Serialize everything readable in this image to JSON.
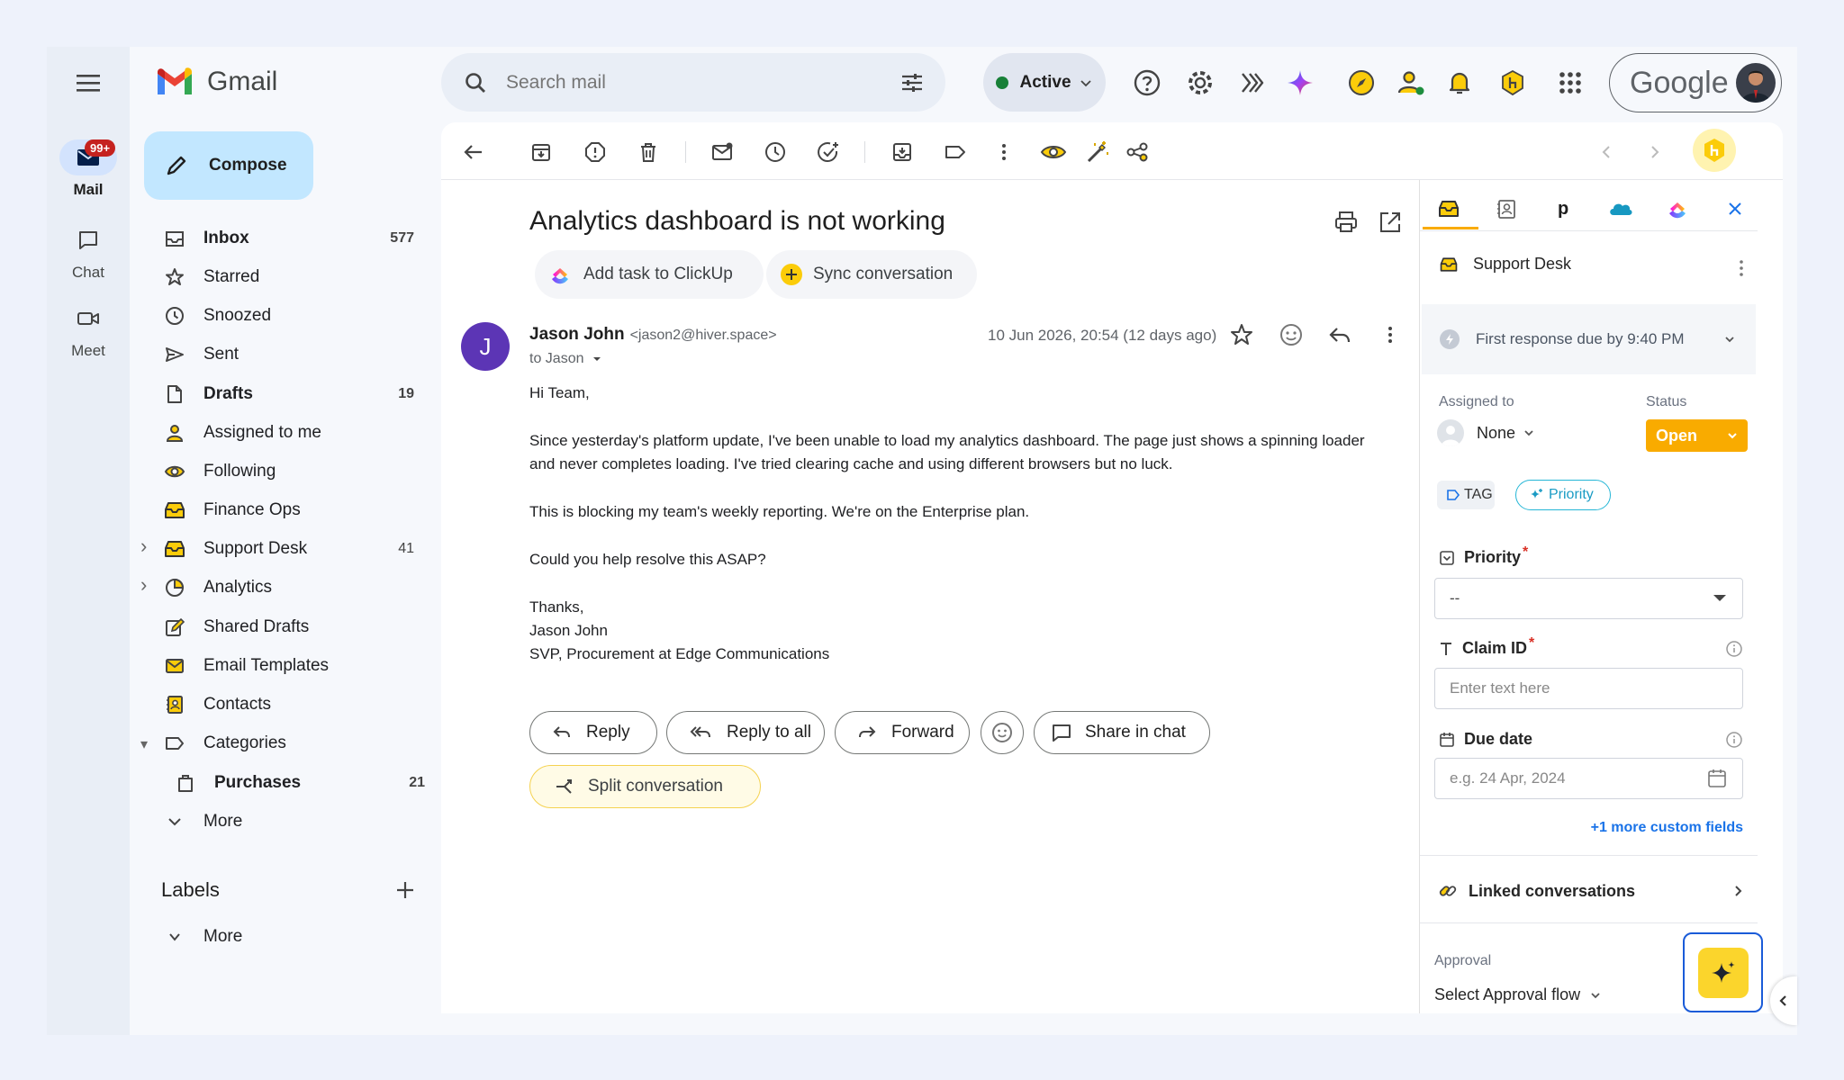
{
  "app": {
    "name": "Gmail"
  },
  "rail": [
    {
      "label": "Mail",
      "badge": "99+"
    },
    {
      "label": "Chat"
    },
    {
      "label": "Meet"
    }
  ],
  "compose": {
    "label": "Compose"
  },
  "nav": [
    {
      "label": "Inbox",
      "count": "577",
      "bold": true,
      "icon": "inbox-icon"
    },
    {
      "label": "Starred",
      "count": "",
      "icon": "star-icon"
    },
    {
      "label": "Snoozed",
      "count": "",
      "icon": "clock-icon"
    },
    {
      "label": "Sent",
      "count": "",
      "icon": "send-icon"
    },
    {
      "label": "Drafts",
      "count": "19",
      "bold": true,
      "icon": "draft-icon"
    },
    {
      "label": "Assigned to me",
      "count": "",
      "icon": "person-icon"
    },
    {
      "label": "Following",
      "count": "",
      "icon": "eye-icon"
    },
    {
      "label": "Finance Ops",
      "count": "",
      "icon": "shared-inbox-icon"
    },
    {
      "label": "Support Desk",
      "count": "41",
      "icon": "shared-inbox-icon"
    },
    {
      "label": "Analytics",
      "count": "",
      "icon": "pie-chart-icon"
    },
    {
      "label": "Shared Drafts",
      "count": "",
      "icon": "shared-draft-icon"
    },
    {
      "label": "Email Templates",
      "count": "",
      "icon": "template-icon"
    },
    {
      "label": "Contacts",
      "count": "",
      "icon": "contacts-icon"
    },
    {
      "label": "Categories",
      "count": "",
      "icon": "label-icon"
    },
    {
      "label": "Purchases",
      "count": "21",
      "bold": true,
      "icon": "bag-icon"
    },
    {
      "label": "More",
      "count": "",
      "icon": "chevron-down-icon"
    }
  ],
  "labels": {
    "title": "Labels",
    "more": "More"
  },
  "search": {
    "placeholder": "Search mail"
  },
  "status": {
    "label": "Active",
    "color": "#188038"
  },
  "account": {
    "brand": "Google"
  },
  "email": {
    "subject": "Analytics dashboard is not working",
    "chips": {
      "clickup": "Add task to ClickUp",
      "sync": "Sync conversation"
    },
    "sender_initial": "J",
    "sender_name": "Jason John",
    "sender_email": "<jason2@hiver.space>",
    "to": "to Jason",
    "date": "10 Jun 2026, 20:54 (12 days ago)",
    "greeting": "Hi Team,",
    "para1_line1": "Since yesterday's platform update, I've been unable to load my analytics dashboard. The page just shows a spinning loader",
    "para1_line2": "and never completes loading. I've tried clearing cache and using different browsers but no luck.",
    "para2": "This is blocking my team's weekly reporting. We're on the Enterprise plan.",
    "para3": "Could you help resolve this ASAP?",
    "sig1": "Thanks,",
    "sig2": "Jason John",
    "sig3": "SVP, Procurement at Edge Communications"
  },
  "actions": {
    "reply": "Reply",
    "reply_all": "Reply to all",
    "forward": "Forward",
    "share_chat": "Share in chat",
    "split": "Split conversation"
  },
  "panel": {
    "inbox_name": "Support Desk",
    "sla": "First response due by 9:40 PM",
    "assigned_label": "Assigned to",
    "assigned_value": "None",
    "status_label": "Status",
    "status_value": "Open",
    "status_color": "#f9ab00",
    "tag_label": "TAG",
    "priority_chip": "Priority",
    "priority_field_label": "Priority",
    "priority_value": "--",
    "claim_label": "Claim ID",
    "claim_placeholder": "Enter text here",
    "due_label": "Due date",
    "due_placeholder": "e.g. 24 Apr, 2024",
    "more_fields": "+1 more custom fields",
    "linked": "Linked conversations",
    "approval_label": "Approval",
    "approval_value": "Select Approval flow"
  }
}
